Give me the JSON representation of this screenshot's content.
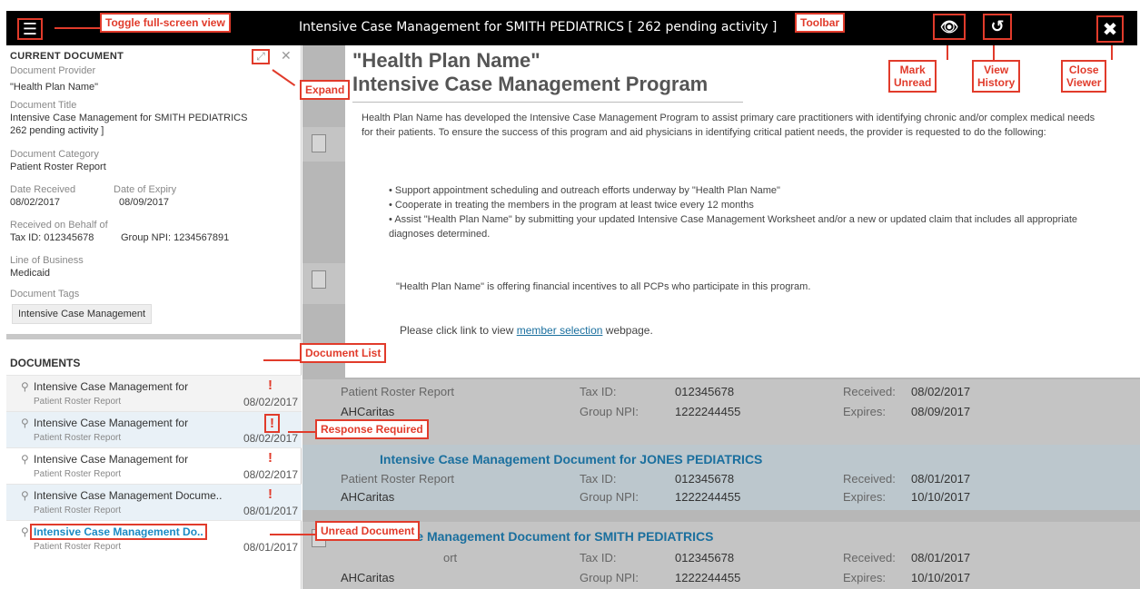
{
  "toolbar": {
    "title": "Intensive Case Management for  SMITH PEDIATRICS [ 262 pending activity ]",
    "menu_icon": "hamburger-icon",
    "unread_icon": "eye-slash-icon",
    "history_icon": "history-icon",
    "close_icon": "close-icon"
  },
  "current": {
    "heading": "CURRENT DOCUMENT",
    "provider_label": "Document Provider",
    "provider": "\"Health Plan Name\"",
    "title_label": "Document Title",
    "title_line1": "Intensive Case Management for SMITH PEDIATRICS",
    "title_line2": "262 pending activity ]",
    "category_label": "Document Category",
    "category": "Patient Roster Report",
    "received_label": "Date Received",
    "received": "08/02/2017",
    "expiry_label": "Date of Expiry",
    "expiry": "08/09/2017",
    "behalf_label": "Received on Behalf of",
    "tax_id": "Tax ID:  012345678",
    "group_npi": "Group NPI:  1234567891",
    "lob_label": "Line of Business",
    "lob": "Medicaid",
    "tags_label": "Document Tags",
    "tag": "Intensive Case Management"
  },
  "documents": {
    "heading": "DOCUMENTS",
    "rows": [
      {
        "title": "Intensive Case Management for",
        "category": "Patient Roster Report",
        "date": "08/02/2017"
      },
      {
        "title": "Intensive Case Management for",
        "category": "Patient Roster Report",
        "date": "08/02/2017"
      },
      {
        "title": "Intensive Case Management for",
        "category": "Patient Roster Report",
        "date": "08/02/2017"
      },
      {
        "title": "Intensive Case Management Docume..",
        "category": "Patient Roster Report",
        "date": "08/01/2017"
      },
      {
        "title": "Intensive Case Management Do..",
        "category": "Patient Roster Report",
        "date": "08/01/2017"
      }
    ]
  },
  "overlay": {
    "plan": "\"Health Plan Name\"",
    "title": "Intensive Case Management Program",
    "paragraph": "Health Plan Name  has developed the Intensive Case  Management Program to assist primary care practitioners with identifying  chronic and/or complex medical needs for their patients. To ensure the success of this program and aid physicians in identifying critical patient needs, the provider is requested to do the following:",
    "bullets": [
      "Support appointment scheduling and outreach efforts underway by  \"Health Plan Name\"",
      "Cooperate in treating the members in the program at least twice every 12 months",
      "Assist  \"Health Plan Name\"  by submitting your updated Intensive Case Management Worksheet and/or a new or updated claim that includes all appropriate diagnoses determined."
    ],
    "incentive": "\"Health Plan Name\"  is offering financial incentives to all PCPs who participate in this program.",
    "link_prefix": "Please click link to view ",
    "link_text": "member selection",
    "link_suffix": " webpage."
  },
  "background": {
    "row1": {
      "category": "Patient Roster Report",
      "tax_label": "Tax ID:",
      "tax": "012345678",
      "rec_label": "Received:",
      "rec": "08/02/2017",
      "source": "AHCaritas",
      "npi_label": "Group NPI:",
      "npi": "1222244455",
      "exp_label": "Expires:",
      "exp": "08/09/2017"
    },
    "row2": {
      "title": "Intensive Case Management Document for  JONES PEDIATRICS",
      "category": "Patient Roster Report",
      "tax_label": "Tax ID:",
      "tax": "012345678",
      "rec_label": "Received:",
      "rec": "08/01/2017",
      "source": "AHCaritas",
      "npi_label": "Group NPI:",
      "npi": "1222244455",
      "exp_label": "Expires:",
      "exp": "10/10/2017"
    },
    "row3": {
      "title": "Intensive Case Management Document for  SMITH PEDIATRICS",
      "category": "ort",
      "tax_label": "Tax ID:",
      "tax": "012345678",
      "rec_label": "Received:",
      "rec": "08/01/2017",
      "source": "AHCaritas",
      "npi_label": "Group NPI:",
      "npi": "1222244455",
      "exp_label": "Expires:",
      "exp": "10/10/2017"
    }
  },
  "callouts": {
    "toggle": "Toggle full-screen view",
    "toolbar": "Toolbar",
    "expand": "Expand",
    "mark_unread": "Mark\nUnread",
    "view_history": "View\nHistory",
    "close_viewer": "Close\nViewer",
    "document_list": "Document List",
    "response_required": "Response Required",
    "unread_document": "Unread Document"
  },
  "colors": {
    "accent": "#e13b2b",
    "link": "#1a6f9e",
    "unread": "#1a8ac4"
  }
}
